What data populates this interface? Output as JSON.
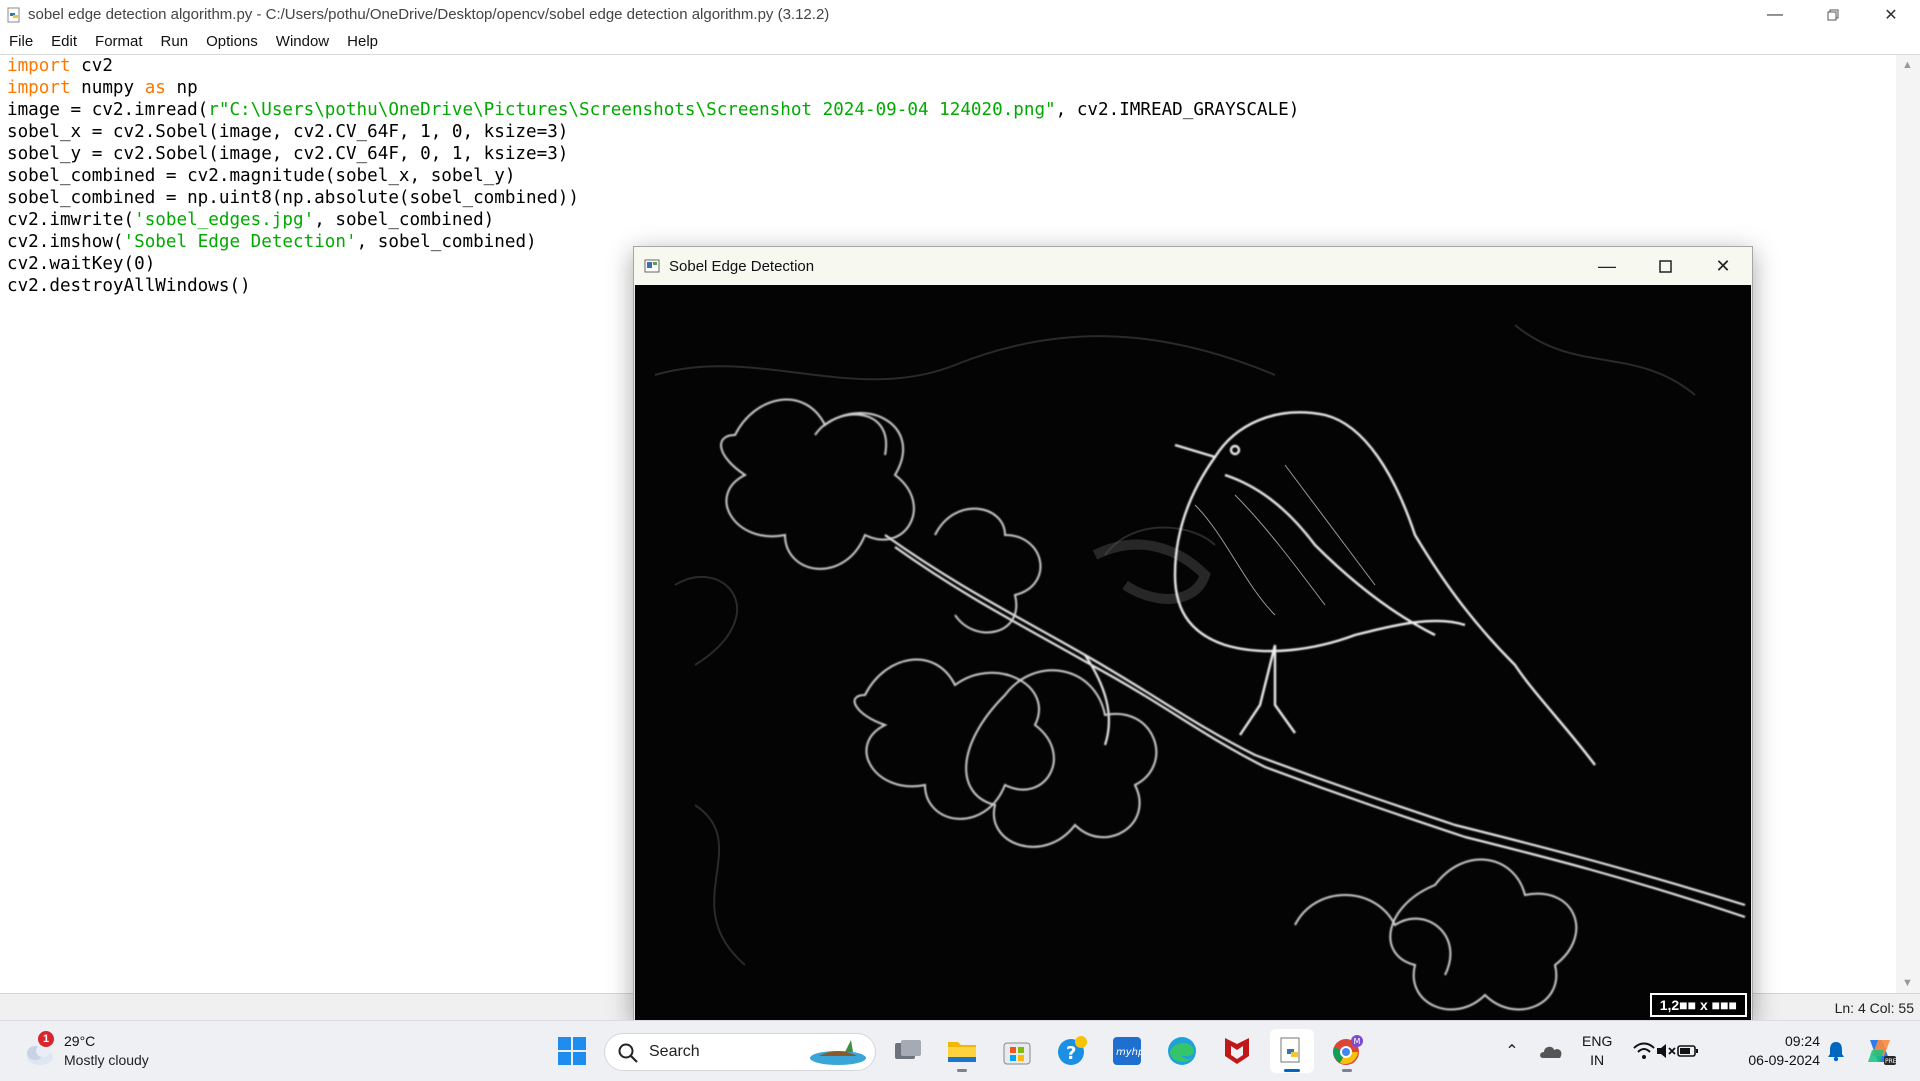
{
  "idle": {
    "title": "sobel edge detection algorithm.py - C:/Users/pothu/OneDrive/Desktop/opencv/sobel edge detection algorithm.py (3.12.2)",
    "menu": [
      "File",
      "Edit",
      "Format",
      "Run",
      "Options",
      "Window",
      "Help"
    ],
    "code_lines": [
      [
        {
          "t": "import",
          "c": "kw"
        },
        {
          "t": " cv2"
        }
      ],
      [
        {
          "t": "import",
          "c": "kw"
        },
        {
          "t": " numpy "
        },
        {
          "t": "as",
          "c": "kw"
        },
        {
          "t": " np"
        }
      ],
      [
        {
          "t": "image = cv2.imread("
        },
        {
          "t": "r\"C:\\Users\\pothu\\OneDrive\\Pictures\\Screenshots\\Screenshot 2024-09-04 124020.png\"",
          "c": "str"
        },
        {
          "t": ", cv2.IMREAD_GRAYSCALE)"
        }
      ],
      [
        {
          "t": "sobel_x = cv2.Sobel(image, cv2.CV_64F, 1, 0, ksize=3)"
        }
      ],
      [
        {
          "t": "sobel_y = cv2.Sobel(image, cv2.CV_64F, 0, 1, ksize=3)"
        }
      ],
      [
        {
          "t": "sobel_combined = cv2.magnitude(sobel_x, sobel_y)"
        }
      ],
      [
        {
          "t": "sobel_combined = np.uint8(np.absolute(sobel_combined))"
        }
      ],
      [
        {
          "t": "cv2.imwrite("
        },
        {
          "t": "'sobel_edges.jpg'",
          "c": "str"
        },
        {
          "t": ", sobel_combined)"
        }
      ],
      [
        {
          "t": "cv2.imshow("
        },
        {
          "t": "'Sobel Edge Detection'",
          "c": "str"
        },
        {
          "t": ", sobel_combined)"
        }
      ],
      [
        {
          "t": "cv2.waitKey(0)"
        }
      ],
      [
        {
          "t": "cv2.destroyAllWindows()"
        }
      ]
    ],
    "status": "Ln: 4   Col: 55"
  },
  "cv_window": {
    "title": "Sobel Edge Detection",
    "size_badge": "1,2■■ x ■■■"
  },
  "taskbar": {
    "weather_temp": "29°C",
    "weather_desc": "Mostly cloudy",
    "weather_badge": "1",
    "search_label": "Search",
    "lang_line1": "ENG",
    "lang_line2": "IN",
    "time": "09:24",
    "date": "06-09-2024"
  },
  "icons": {
    "window_controls": [
      "minimize-icon",
      "restore-icon",
      "close-icon"
    ],
    "taskbar_apps": [
      "start-icon",
      "task-view-icon",
      "file-explorer-icon",
      "microsoft-store-icon",
      "help-icon",
      "myhp-icon",
      "edge-icon",
      "mcafee-icon",
      "idle-icon",
      "chrome-icon"
    ],
    "tray": [
      "chevron-up-icon",
      "onedrive-icon",
      "wifi-icon",
      "mute-icon",
      "battery-icon",
      "notification-icon",
      "copilot-icon"
    ]
  }
}
